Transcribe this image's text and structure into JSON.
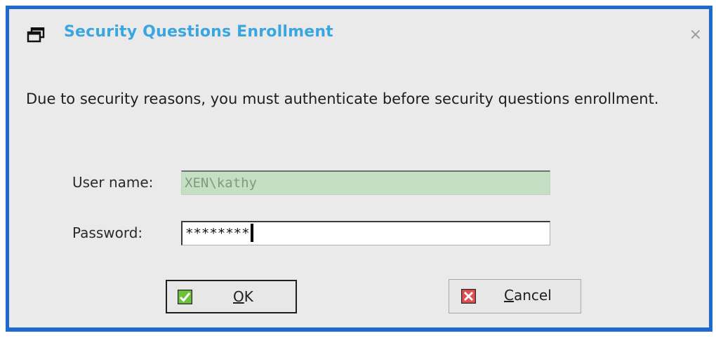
{
  "dialog": {
    "title": "Security Questions Enrollment",
    "close_symbol": "×",
    "message": "Due to security reasons, you must authenticate before security questions enrollment."
  },
  "form": {
    "username_label": "User name:",
    "username_value": "XEN\\kathy",
    "password_label": "Password:",
    "password_value": "********"
  },
  "buttons": {
    "ok": {
      "mnemonic": "O",
      "rest": "K",
      "icon": "check-icon"
    },
    "cancel": {
      "mnemonic": "C",
      "rest": "ancel",
      "icon": "x-icon"
    }
  },
  "colors": {
    "frame_border": "#1f6ad0",
    "title_text": "#3aa6e0",
    "readonly_field_bg": "#c5dfc5",
    "ok_icon": "#6ec13c",
    "cancel_icon": "#e05050"
  }
}
